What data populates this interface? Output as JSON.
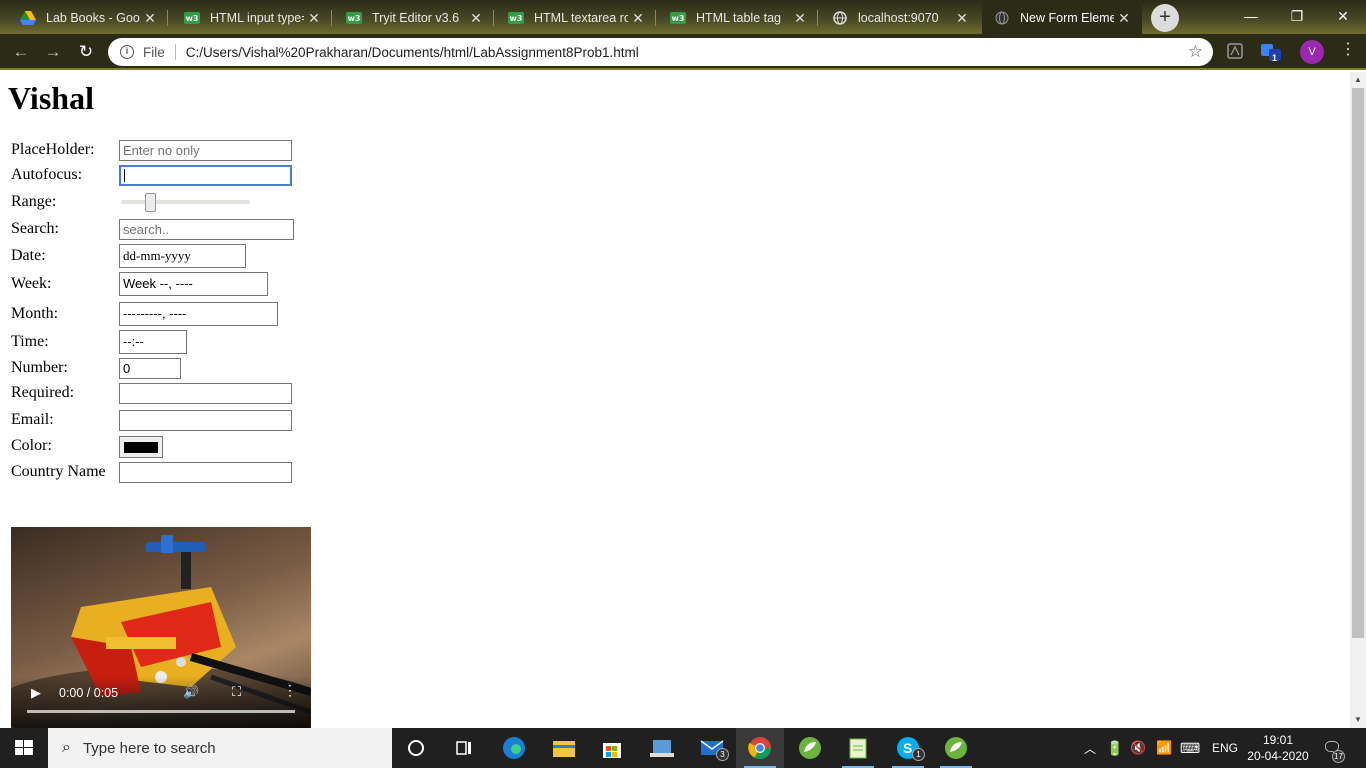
{
  "browser": {
    "tabs": [
      {
        "title": "Lab Books - Googl",
        "icon": "google-drive-icon"
      },
      {
        "title": "HTML input type=",
        "icon": "w3schools-icon"
      },
      {
        "title": "Tryit Editor v3.6",
        "icon": "w3schools-icon"
      },
      {
        "title": "HTML textarea row",
        "icon": "w3schools-icon"
      },
      {
        "title": "HTML table tag",
        "icon": "w3schools-icon"
      },
      {
        "title": "localhost:9070",
        "icon": "globe-icon"
      },
      {
        "title": "New Form Elemen",
        "icon": "globe-icon",
        "active": true
      }
    ],
    "new_tab_label": "+",
    "address": {
      "scheme_label": "File",
      "url": "C:/Users/Vishal%20Prakharan/Documents/html/LabAssignment8Prob1.html"
    },
    "profile_initial": "V",
    "extension_badge": "1"
  },
  "page": {
    "heading": "Vishal",
    "form": {
      "placeholder_label": "PlaceHolder:",
      "placeholder_hint": "Enter no only",
      "autofocus_label": "Autofocus:",
      "range_label": "Range:",
      "range_value": 0.2,
      "search_label": "Search:",
      "search_hint": "search..",
      "date_label": "Date:",
      "date_value": "dd-mm-yyyy",
      "week_label": "Week:",
      "week_value": "Week --, ----",
      "month_label": "Month:",
      "month_value": "---------, ----",
      "time_label": "Time:",
      "time_value": "--:--",
      "number_label": "Number:",
      "number_value": "0",
      "required_label": "Required:",
      "email_label": "Email:",
      "color_label": "Color:",
      "color_value": "#000000",
      "country_label": "Country Name"
    },
    "video": {
      "time": "0:00 / 0:05"
    }
  },
  "taskbar": {
    "search_placeholder": "Type here to search",
    "badges": {
      "mail": "3",
      "skype": "1"
    },
    "tray_lang": "ENG",
    "time": "19:01",
    "date": "20-04-2020",
    "notifications": "17"
  },
  "colors": {
    "theme_dark": "#2b2b17",
    "focus_ring": "#4a7ed6",
    "profile": "#9c27b0"
  }
}
